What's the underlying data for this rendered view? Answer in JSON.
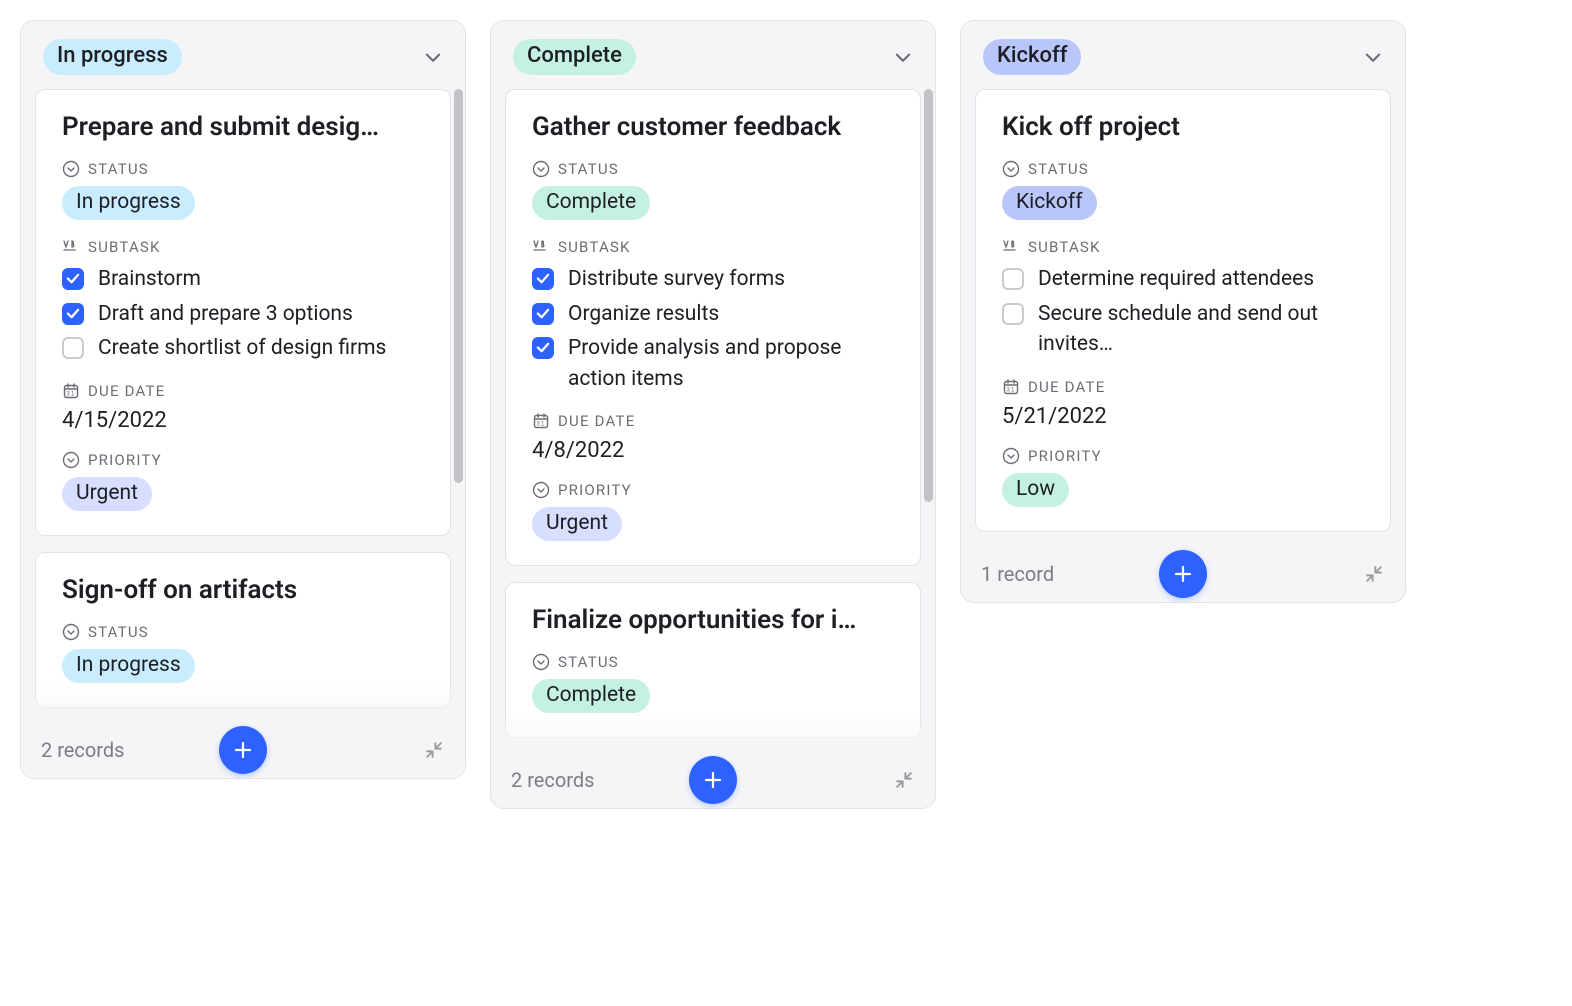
{
  "labels": {
    "status": "STATUS",
    "subtask": "SUBTASK",
    "due_date": "DUE DATE",
    "priority": "PRIORITY"
  },
  "columns": [
    {
      "name": "In progress",
      "pill_class": "pill-cyan",
      "record_count": "2 records",
      "has_scroll": true,
      "scroll_height_pct": 62,
      "faded": true,
      "cards": [
        {
          "title": "Prepare and submit desig…",
          "status": {
            "text": "In progress",
            "class": "pill-cyan"
          },
          "subtasks": [
            {
              "text": "Brainstorm",
              "checked": true
            },
            {
              "text": "Draft and prepare 3 options",
              "checked": true
            },
            {
              "text": "Create shortlist of design firms",
              "checked": false
            }
          ],
          "due_date": "4/15/2022",
          "priority": {
            "text": "Urgent",
            "class": "pill-lavender"
          }
        },
        {
          "title": "Sign-off on artifacts",
          "status": {
            "text": "In progress",
            "class": "pill-cyan"
          },
          "truncated": true
        }
      ]
    },
    {
      "name": "Complete",
      "pill_class": "pill-teal",
      "record_count": "2 records",
      "has_scroll": true,
      "scroll_height_pct": 62,
      "faded": true,
      "cards": [
        {
          "title": "Gather customer feedback",
          "status": {
            "text": "Complete",
            "class": "pill-teal"
          },
          "subtasks": [
            {
              "text": "Distribute survey forms",
              "checked": true
            },
            {
              "text": "Organize results",
              "checked": true
            },
            {
              "text": "Provide analysis and propose action items",
              "checked": true
            }
          ],
          "due_date": "4/8/2022",
          "priority": {
            "text": "Urgent",
            "class": "pill-lavender"
          }
        },
        {
          "title": "Finalize opportunities for i…",
          "status": {
            "text": "Complete",
            "class": "pill-teal"
          },
          "truncated": true
        }
      ]
    },
    {
      "name": "Kickoff",
      "pill_class": "pill-blue",
      "record_count": "1 record",
      "has_scroll": false,
      "faded": false,
      "cards": [
        {
          "title": "Kick off project",
          "status": {
            "text": "Kickoff",
            "class": "pill-blue"
          },
          "subtasks": [
            {
              "text": "Determine required attendees",
              "checked": false
            },
            {
              "text": "Secure schedule and send out invites…",
              "checked": false
            }
          ],
          "due_date": "5/21/2022",
          "priority": {
            "text": "Low",
            "class": "pill-teal"
          }
        }
      ]
    }
  ]
}
